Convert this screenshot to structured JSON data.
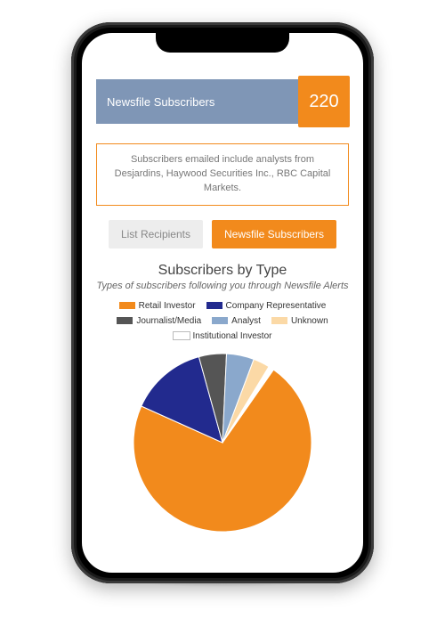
{
  "header": {
    "title": "Newsfile Subscribers",
    "count": "220"
  },
  "callout": {
    "text": "Subscribers emailed include analysts from Desjardins, Haywood Securities Inc., RBC Capital Markets."
  },
  "tabs": {
    "list_recipients": "List Recipients",
    "newsfile_subscribers": "Newsfile Subscribers"
  },
  "chart_data": {
    "type": "pie",
    "title": "Subscribers by Type",
    "subtitle": "Types of subscribers following you through Newsfile Alerts",
    "series": [
      {
        "name": "Retail Investor",
        "value": 72,
        "color": "#f28a1c"
      },
      {
        "name": "Company Representative",
        "value": 14,
        "color": "#222a8e"
      },
      {
        "name": "Journalist/Media",
        "value": 5,
        "color": "#555555"
      },
      {
        "name": "Analyst",
        "value": 5,
        "color": "#8aa8cc"
      },
      {
        "name": "Unknown",
        "value": 3,
        "color": "#fbd9a6"
      },
      {
        "name": "Institutional Investor",
        "value": 1,
        "color": "#ffffff"
      }
    ]
  }
}
